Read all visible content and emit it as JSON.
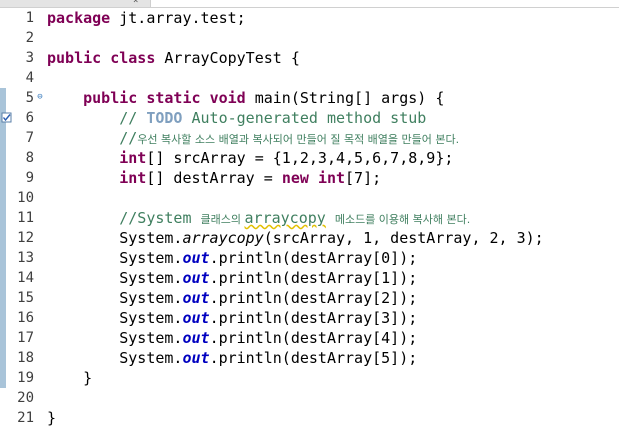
{
  "editor": {
    "lines": [
      {
        "no": "1",
        "code": [
          {
            "t": "package",
            "c": "kw"
          },
          {
            "t": " jt.array.test;"
          }
        ]
      },
      {
        "no": "2",
        "code": []
      },
      {
        "no": "3",
        "code": [
          {
            "t": "public",
            "c": "kw"
          },
          {
            "t": " "
          },
          {
            "t": "class",
            "c": "kw"
          },
          {
            "t": " ArrayCopyTest {"
          }
        ]
      },
      {
        "no": "4",
        "code": []
      },
      {
        "no": "5",
        "fold": "⊖",
        "code": [
          {
            "t": "    "
          },
          {
            "t": "public",
            "c": "kw"
          },
          {
            "t": " "
          },
          {
            "t": "static",
            "c": "kw"
          },
          {
            "t": " "
          },
          {
            "t": "void",
            "c": "kw"
          },
          {
            "t": " main(String[] args) {"
          }
        ]
      },
      {
        "no": "6",
        "task": true,
        "code": [
          {
            "t": "        "
          },
          {
            "t": "// ",
            "c": "cm"
          },
          {
            "t": "TODO",
            "c": "todo"
          },
          {
            "t": " Auto-generated method stub",
            "c": "cm"
          }
        ]
      },
      {
        "no": "7",
        "code": [
          {
            "t": "        "
          },
          {
            "t": "//",
            "c": "cm"
          },
          {
            "t": "우선 복사할 소스 배열과 복사되어 만들어 질 목적 배열을 만들어 본다.",
            "c": "cm kr"
          }
        ]
      },
      {
        "no": "8",
        "code": [
          {
            "t": "        "
          },
          {
            "t": "int",
            "c": "kw"
          },
          {
            "t": "[] srcArray = {1,2,3,4,5,6,7,8,9};"
          }
        ]
      },
      {
        "no": "9",
        "code": [
          {
            "t": "        "
          },
          {
            "t": "int",
            "c": "kw"
          },
          {
            "t": "[] destArray = "
          },
          {
            "t": "new",
            "c": "kw"
          },
          {
            "t": " "
          },
          {
            "t": "int",
            "c": "kw"
          },
          {
            "t": "[7];"
          }
        ]
      },
      {
        "no": "10",
        "code": []
      },
      {
        "no": "11",
        "code": [
          {
            "t": "        "
          },
          {
            "t": "//System ",
            "c": "cm"
          },
          {
            "t": "클래스의 ",
            "c": "cm kr"
          },
          {
            "t": "arraycopy",
            "c": "cm squiggle"
          },
          {
            "t": " ",
            "c": "cm"
          },
          {
            "t": "메소드를 이용해 복사해 본다.",
            "c": "cm kr"
          }
        ]
      },
      {
        "no": "12",
        "code": [
          {
            "t": "        System."
          },
          {
            "t": "arraycopy",
            "c": "static-m"
          },
          {
            "t": "(srcArray, 1, destArray, 2, 3);"
          }
        ]
      },
      {
        "no": "13",
        "code": [
          {
            "t": "        System."
          },
          {
            "t": "out",
            "c": "field"
          },
          {
            "t": ".println(destArray[0]);"
          }
        ]
      },
      {
        "no": "14",
        "code": [
          {
            "t": "        System."
          },
          {
            "t": "out",
            "c": "field"
          },
          {
            "t": ".println(destArray[1]);"
          }
        ]
      },
      {
        "no": "15",
        "code": [
          {
            "t": "        System."
          },
          {
            "t": "out",
            "c": "field"
          },
          {
            "t": ".println(destArray[2]);"
          }
        ]
      },
      {
        "no": "16",
        "code": [
          {
            "t": "        System."
          },
          {
            "t": "out",
            "c": "field"
          },
          {
            "t": ".println(destArray[3]);"
          }
        ]
      },
      {
        "no": "17",
        "code": [
          {
            "t": "        System."
          },
          {
            "t": "out",
            "c": "field"
          },
          {
            "t": ".println(destArray[4]);"
          }
        ]
      },
      {
        "no": "18",
        "code": [
          {
            "t": "        System."
          },
          {
            "t": "out",
            "c": "field"
          },
          {
            "t": ".println(destArray[5]);"
          }
        ]
      },
      {
        "no": "19",
        "code": [
          {
            "t": "    }"
          }
        ]
      },
      {
        "no": "20",
        "code": []
      },
      {
        "no": "21",
        "code": [
          {
            "t": "}"
          }
        ]
      }
    ]
  },
  "colors": {
    "keyword": "#7f0055",
    "comment": "#3f7f5f",
    "todo": "#7f9fbf",
    "field": "#0000c0",
    "change_ruler": "#a9c4d9"
  },
  "icons": {
    "fold": "fold-collapse-icon",
    "task": "task-marker-icon"
  }
}
